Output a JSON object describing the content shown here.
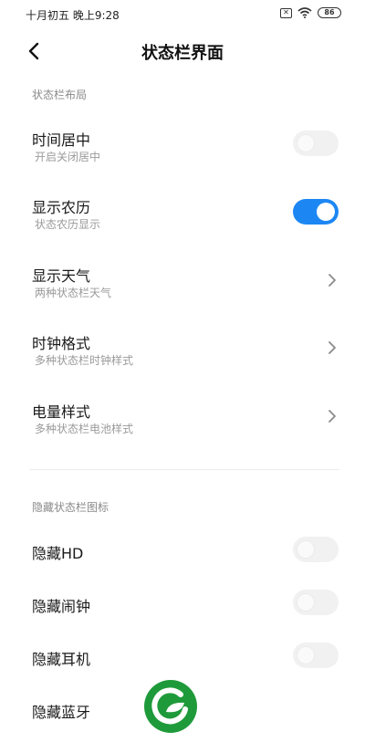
{
  "status_bar": {
    "time": "十月初五 晚上9:28",
    "battery": "86",
    "icons": [
      "sim-x-icon",
      "wifi-icon",
      "battery-icon"
    ]
  },
  "header": {
    "title": "状态栏界面"
  },
  "sections": {
    "layout": {
      "label": "状态栏布局",
      "items": [
        {
          "title": "时间居中",
          "subtitle": "开启关闭居中",
          "control": "toggle",
          "on": false
        },
        {
          "title": "显示农历",
          "subtitle": "状态农历显示",
          "control": "toggle",
          "on": true
        },
        {
          "title": "显示天气",
          "subtitle": "两种状态栏天气",
          "control": "chevron"
        },
        {
          "title": "时钟格式",
          "subtitle": "多种状态栏时钟样式",
          "control": "chevron"
        },
        {
          "title": "电量样式",
          "subtitle": "多种状态栏电池样式",
          "control": "chevron"
        }
      ]
    },
    "hide_icons": {
      "label": "隐藏状态栏图标",
      "items": [
        {
          "title": "隐藏HD",
          "control": "toggle",
          "on": false
        },
        {
          "title": "隐藏闹钟",
          "control": "toggle",
          "on": false
        },
        {
          "title": "隐藏耳机",
          "control": "toggle",
          "on": false
        },
        {
          "title": "隐藏蓝牙"
        }
      ]
    }
  },
  "colors": {
    "accent": "#1c87f3",
    "toggle_off": "#f1f1f1",
    "logo_green": "#1f9a3a"
  }
}
